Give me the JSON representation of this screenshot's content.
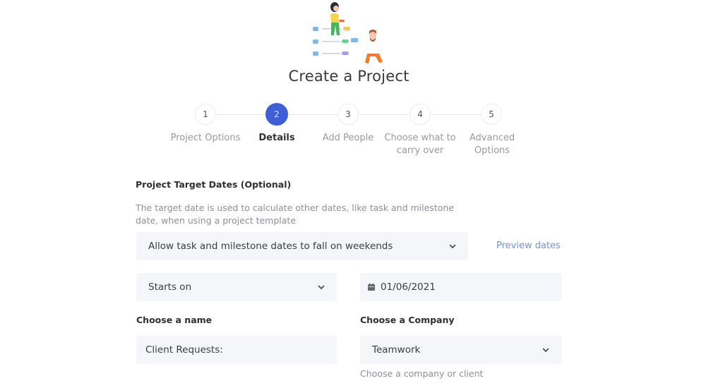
{
  "header": {
    "title": "Create a Project",
    "illustration": "project-team-illustration"
  },
  "stepper": {
    "active_step": 2,
    "steps": [
      {
        "number": "1",
        "label": "Project Options"
      },
      {
        "number": "2",
        "label": "Details"
      },
      {
        "number": "3",
        "label": "Add People"
      },
      {
        "number": "4",
        "label": "Choose what to carry over"
      },
      {
        "number": "5",
        "label": "Advanced Options"
      }
    ]
  },
  "target_dates": {
    "title": "Project Target Dates (Optional)",
    "description": "The target date is used to calculate other dates, like task and milestone date, when using a project template",
    "weekend_select": {
      "value": "Allow task and milestone dates to fall on weekends",
      "icon": "chevron-down-icon"
    },
    "preview_link": "Preview dates",
    "start_mode_select": {
      "value": "Starts on",
      "icon": "chevron-down-icon"
    },
    "date_input": {
      "value": "01/06/2021",
      "icon": "calendar-icon"
    }
  },
  "name_field": {
    "label": "Choose a name",
    "value": "Client Requests:"
  },
  "company_field": {
    "label": "Choose a Company",
    "value": "Teamwork",
    "hint": "Choose a company or client",
    "icon": "chevron-down-icon"
  },
  "colors": {
    "accent": "#3f5fd6",
    "link": "#6f95d6",
    "field_bg": "#f5f6fa",
    "muted_text": "#8e8e98"
  }
}
